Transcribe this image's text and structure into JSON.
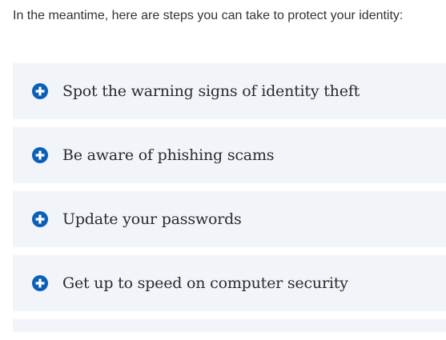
{
  "intro": {
    "text": "In the meantime, here are steps you can take to protect your identity:"
  },
  "accordion": {
    "items": [
      {
        "label": "Spot the warning signs of identity theft"
      },
      {
        "label": "Be aware of phishing scams"
      },
      {
        "label": "Update your passwords"
      },
      {
        "label": "Get up to speed on computer security"
      }
    ]
  },
  "colors": {
    "icon_accent": "#0b5fb8",
    "panel_background": "#f1f4f8",
    "label_text": "#2b2b2b",
    "intro_text": "#333333"
  },
  "icons": {
    "expand": "plus-circle-icon"
  }
}
